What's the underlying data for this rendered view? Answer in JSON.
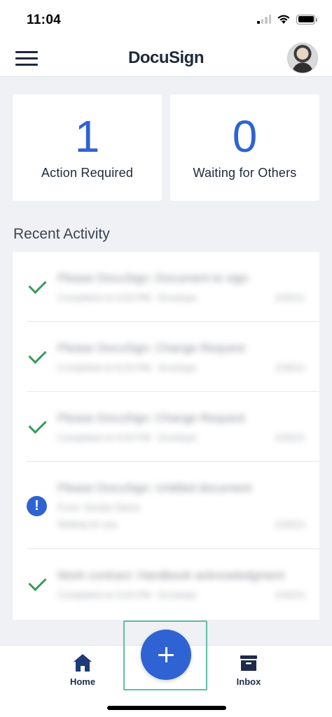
{
  "status_bar": {
    "time": "11:04"
  },
  "header": {
    "brand": "DocuSign",
    "menu_icon": "hamburger-menu-icon",
    "avatar_icon": "user-avatar"
  },
  "summary": {
    "action_required": {
      "count": "1",
      "label": "Action Required"
    },
    "waiting_for_others": {
      "count": "0",
      "label": "Waiting for Others"
    }
  },
  "recent_activity": {
    "title": "Recent Activity",
    "items": [
      {
        "status": "completed",
        "icon": "check-icon",
        "title": "Please DocuSign: Document to sign",
        "subtitle": "Completed on 6:03 PM · Envelope",
        "date": "2/26/21"
      },
      {
        "status": "completed",
        "icon": "check-icon",
        "title": "Please DocuSign: Change Request",
        "subtitle": "Completed on 6:03 PM · Envelope",
        "date": "2/26/21"
      },
      {
        "status": "completed",
        "icon": "check-icon",
        "title": "Please DocuSign: Change Request",
        "subtitle": "Completed on 6:03 PM · Envelope",
        "date": "2/26/21"
      },
      {
        "status": "action_required",
        "icon": "exclamation-icon",
        "title": "Please DocuSign: Untitled document",
        "subtitle": "From: Sender Name",
        "subtitle2": "Waiting for you",
        "date": "2/26/21",
        "badge": "!"
      },
      {
        "status": "completed",
        "icon": "check-icon",
        "title": "Work contract: Handbook acknowledgment",
        "subtitle": "Completed on 6:03 PM · Envelope",
        "date": "2/26/21"
      }
    ]
  },
  "tab_bar": {
    "home_label": "Home",
    "inbox_label": "Inbox",
    "new_button_icon": "plus-icon"
  },
  "colors": {
    "accent": "#2f63d3",
    "success": "#3a9a5b",
    "highlight": "#5fbfa6"
  }
}
